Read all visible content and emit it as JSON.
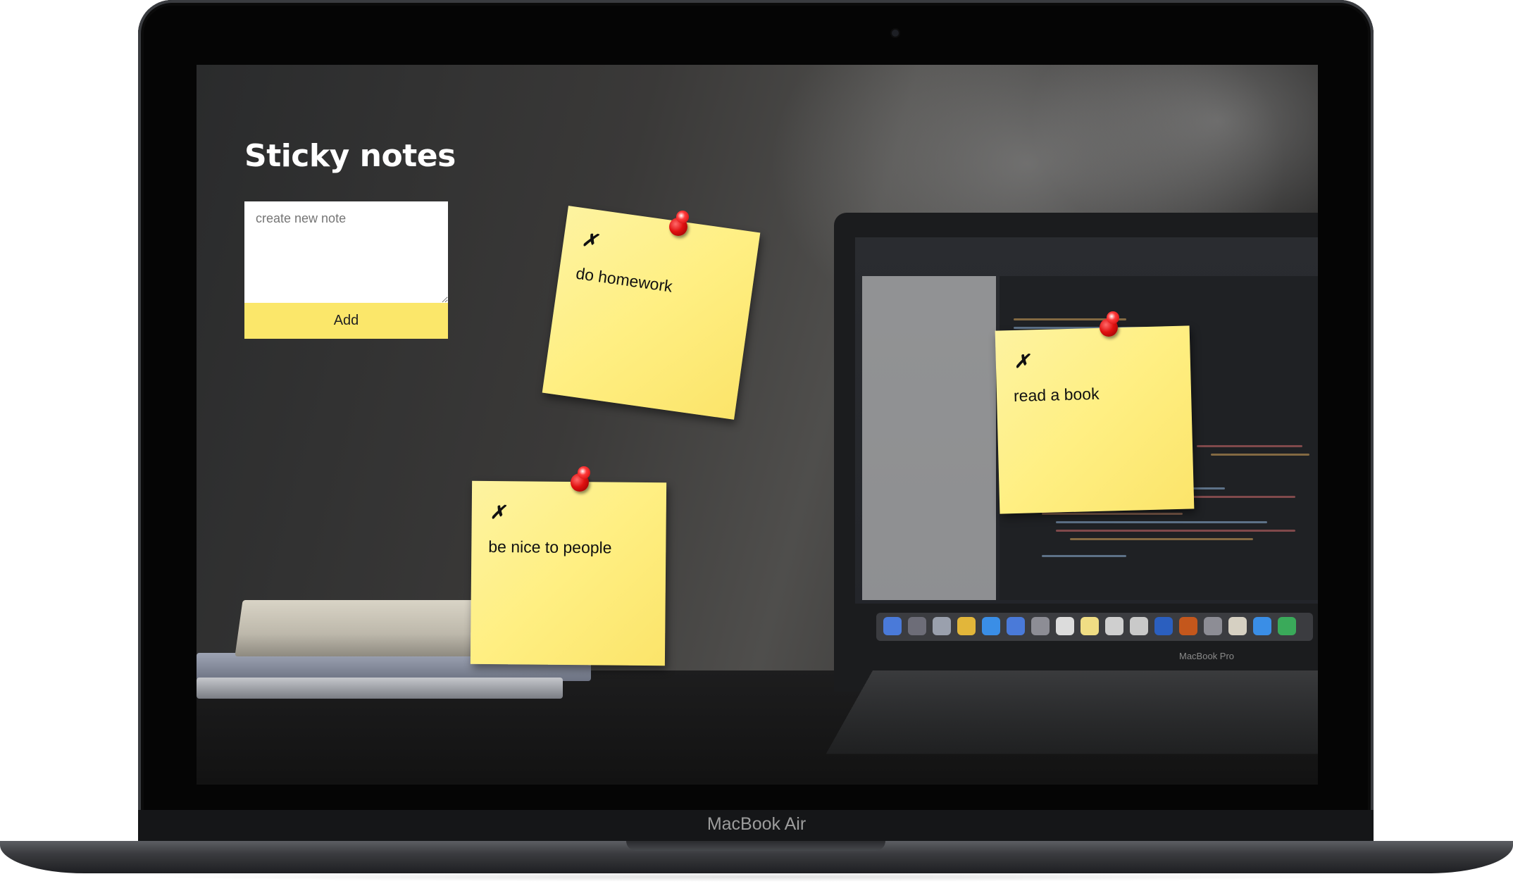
{
  "device": {
    "model_label": "MacBook Air",
    "background_laptop_label": "MacBook Pro"
  },
  "app": {
    "title": "Sticky notes",
    "input_placeholder": "create new note",
    "input_value": "",
    "add_button_label": "Add",
    "delete_glyph": "✗",
    "note_color": "#fbe76a",
    "pin_color": "#e01010"
  },
  "notes": [
    {
      "text": "do homework"
    },
    {
      "text": "be nice to people"
    },
    {
      "text": "read a book"
    }
  ]
}
